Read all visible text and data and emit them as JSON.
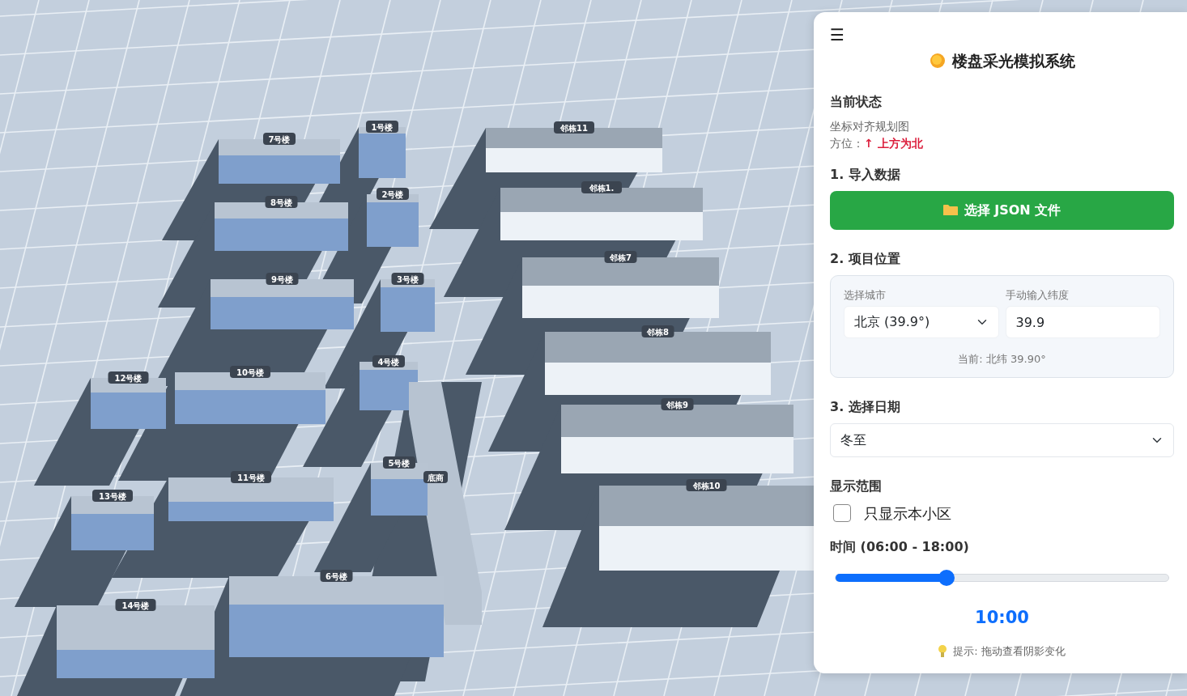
{
  "scene": {
    "buildings": [
      {
        "label": "7号楼",
        "kind": "own"
      },
      {
        "label": "1号楼",
        "kind": "own"
      },
      {
        "label": "8号楼",
        "kind": "own"
      },
      {
        "label": "2号楼",
        "kind": "own"
      },
      {
        "label": "9号楼",
        "kind": "own"
      },
      {
        "label": "3号楼",
        "kind": "own"
      },
      {
        "label": "12号楼",
        "kind": "own"
      },
      {
        "label": "10号楼",
        "kind": "own"
      },
      {
        "label": "4号楼",
        "kind": "own"
      },
      {
        "label": "底商",
        "kind": "shops"
      },
      {
        "label": "5号楼",
        "kind": "own"
      },
      {
        "label": "11号楼",
        "kind": "own"
      },
      {
        "label": "13号楼",
        "kind": "own"
      },
      {
        "label": "6号楼",
        "kind": "own"
      },
      {
        "label": "14号楼",
        "kind": "own"
      },
      {
        "label": "邻栋11",
        "kind": "neighbor"
      },
      {
        "label": "邻栋1.",
        "kind": "neighbor"
      },
      {
        "label": "邻栋7",
        "kind": "neighbor"
      },
      {
        "label": "邻栋8",
        "kind": "neighbor"
      },
      {
        "label": "邻栋9",
        "kind": "neighbor"
      },
      {
        "label": "邻栋10",
        "kind": "neighbor"
      }
    ]
  },
  "panel": {
    "menu_button": "☰",
    "title": "楼盘采光模拟系统",
    "status": {
      "heading": "当前状态",
      "plan": "坐标对齐规划图",
      "orientation_label": "方位：",
      "orientation_value": "↑ 上方为北"
    },
    "import": {
      "heading": "1. 导入数据",
      "button": "选择 JSON 文件"
    },
    "location": {
      "heading": "2. 项目位置",
      "city_label": "选择城市",
      "city_value": "北京 (39.9°)",
      "latitude_label": "手动输入纬度",
      "latitude_value": "39.9",
      "current": "当前: 北纬 39.90°"
    },
    "date": {
      "heading": "3. 选择日期",
      "value": "冬至"
    },
    "range": {
      "heading": "显示范围",
      "checkbox_label": "只显示本小区",
      "checked": false
    },
    "time": {
      "heading": "时间 (06:00 - 18:00)",
      "level": 0.333,
      "reading": "10:00",
      "hint": "提示: 拖动查看阴影变化"
    }
  }
}
